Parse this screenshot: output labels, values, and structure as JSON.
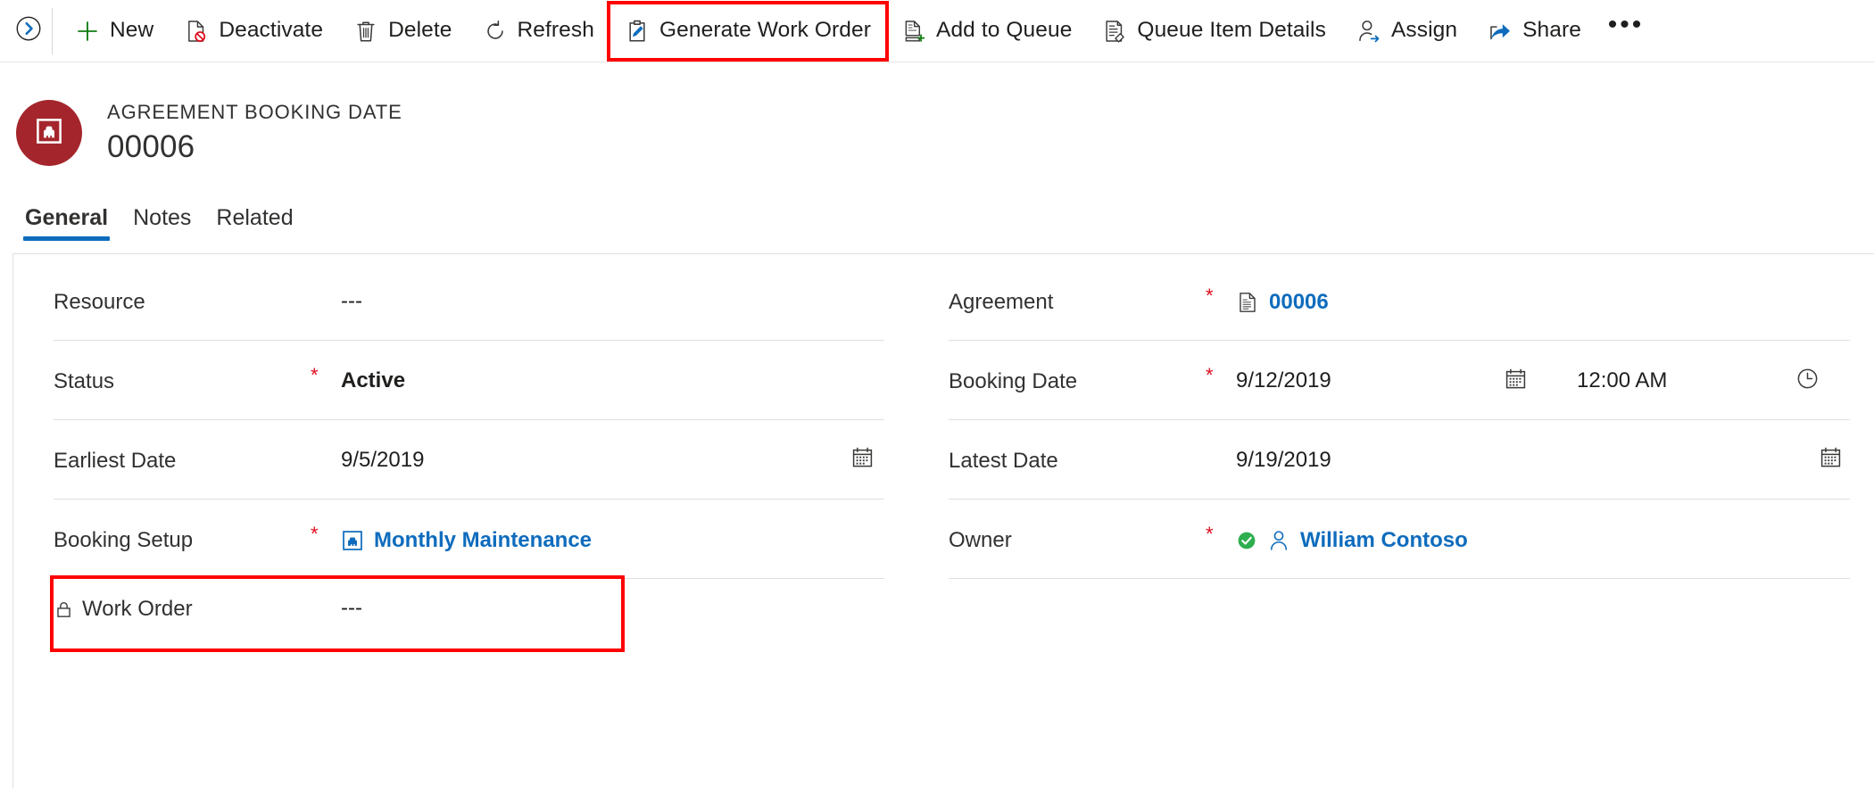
{
  "commandbar": {
    "expand_icon": "chevron-right-circle-icon",
    "overflow_label": "•••",
    "buttons": [
      {
        "label": "New",
        "icon": "plus-icon",
        "highlighted": false
      },
      {
        "label": "Deactivate",
        "icon": "deactivate-icon",
        "highlighted": false
      },
      {
        "label": "Delete",
        "icon": "trash-icon",
        "highlighted": false
      },
      {
        "label": "Refresh",
        "icon": "refresh-icon",
        "highlighted": false
      },
      {
        "label": "Generate Work Order",
        "icon": "clipboard-pen-icon",
        "highlighted": true
      },
      {
        "label": "Add to Queue",
        "icon": "add-to-queue-icon",
        "highlighted": false
      },
      {
        "label": "Queue Item Details",
        "icon": "queue-details-icon",
        "highlighted": false
      },
      {
        "label": "Assign",
        "icon": "assign-person-icon",
        "highlighted": false
      },
      {
        "label": "Share",
        "icon": "share-icon",
        "highlighted": false
      }
    ]
  },
  "record": {
    "entity_label": "AGREEMENT BOOKING DATE",
    "name": "00006",
    "avatar_icon": "agreement-booking-date-icon",
    "avatar_color": "#a4262c"
  },
  "tabs": [
    {
      "label": "General",
      "active": true
    },
    {
      "label": "Notes",
      "active": false
    },
    {
      "label": "Related",
      "active": false
    }
  ],
  "form": {
    "left_fields": [
      {
        "label": "Resource",
        "required": false,
        "value": "---",
        "value_kind": "dashes"
      },
      {
        "label": "Status",
        "required": true,
        "value": "Active",
        "value_kind": "bold-text"
      },
      {
        "label": "Earliest Date",
        "required": false,
        "value": "9/5/2019",
        "value_kind": "text",
        "trailing_icon": "calendar-icon"
      },
      {
        "label": "Booking Setup",
        "required": true,
        "value": "Monthly Maintenance",
        "value_kind": "link",
        "value_icon": "booking-setup-icon"
      },
      {
        "label": "Work Order",
        "required": false,
        "value": "---",
        "value_kind": "dashes",
        "locked": true,
        "lock_icon": "lock-icon",
        "highlighted": true
      }
    ],
    "right_fields": [
      {
        "label": "Agreement",
        "required": true,
        "value": "00006",
        "value_kind": "link",
        "value_icon": "document-icon"
      },
      {
        "label": "Booking Date",
        "required": true,
        "value": "9/12/2019",
        "value_kind": "datetime",
        "time_value": "12:00 AM",
        "date_icon": "calendar-icon",
        "time_icon": "clock-icon"
      },
      {
        "label": "Latest Date",
        "required": false,
        "value": "9/19/2019",
        "value_kind": "text",
        "trailing_icon": "calendar-icon"
      },
      {
        "label": "Owner",
        "required": true,
        "value": "William Contoso",
        "value_kind": "link",
        "status_icon": "green-check-icon",
        "value_icon": "person-icon"
      }
    ]
  },
  "colors": {
    "accent": "#0f6cbd",
    "required_star": "#e00b1c",
    "highlight_border": "#ff0000",
    "avatar": "#a4262c",
    "link": "#0f6cbd",
    "green_status": "#2eae4e",
    "new_icon_green": "#107c10"
  }
}
